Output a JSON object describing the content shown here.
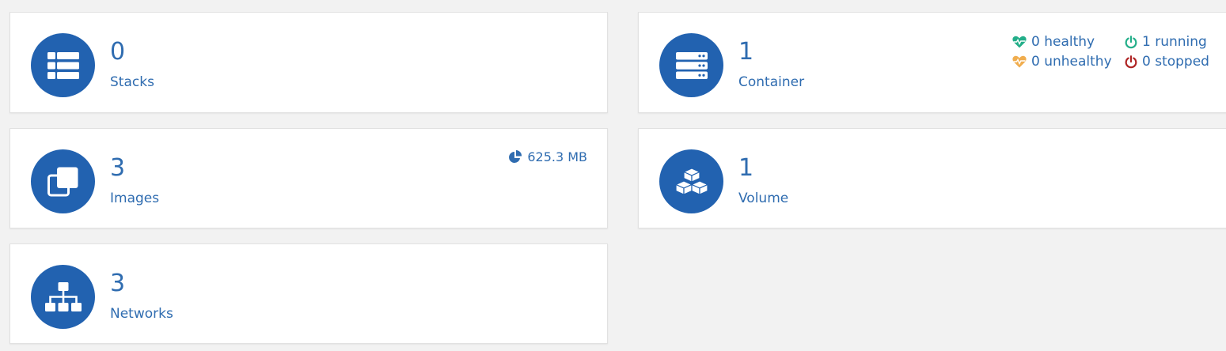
{
  "cards": {
    "stacks": {
      "value": "0",
      "label": "Stacks",
      "icon": "th-list-icon"
    },
    "containers": {
      "value": "1",
      "label": "Container",
      "icon": "server-icon",
      "status": {
        "healthy": "0 healthy",
        "running": "1 running",
        "unhealthy": "0 unhealthy",
        "stopped": "0 stopped"
      }
    },
    "images": {
      "value": "3",
      "label": "Images",
      "icon": "clone-icon",
      "size": "625.3 MB"
    },
    "volumes": {
      "value": "1",
      "label": "Volume",
      "icon": "cubes-icon"
    },
    "networks": {
      "value": "3",
      "label": "Networks",
      "icon": "sitemap-icon"
    }
  },
  "colors": {
    "accent": "#2262b0",
    "text": "#2f6cb0",
    "healthy": "#23ae89",
    "running": "#23ae89",
    "unhealthy": "#f0ad4e",
    "stopped": "#ae2323",
    "background": "#f2f2f2"
  }
}
